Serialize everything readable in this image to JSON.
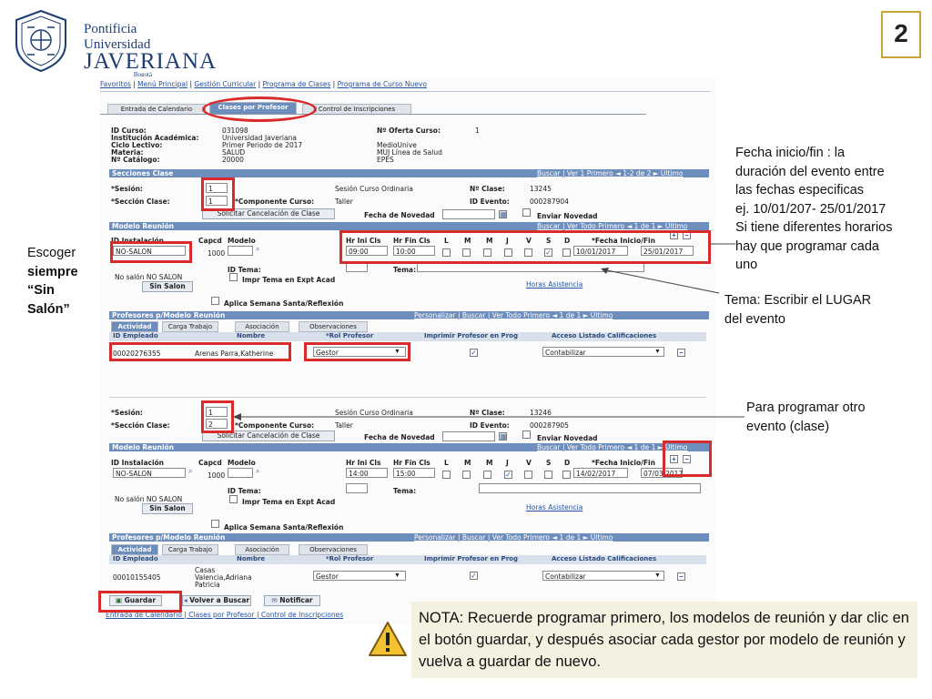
{
  "slide": {
    "page_number": "2"
  },
  "logo": {
    "line1": "Pontificia Universidad",
    "line2": "JAVERIANA",
    "line3": "Bogotá"
  },
  "breadcrumb": [
    "Favoritos",
    "Menú Principal",
    "Gestión Curricular",
    "Programa de Clases",
    "Programa de Curso Nuevo"
  ],
  "tabs": [
    "Entrada de Calendario",
    "Clases por Profesor",
    "Control de Inscripciones"
  ],
  "course_info": {
    "id_curso_label": "ID Curso:",
    "id_curso": "031098",
    "institucion_label": "Institución Académica:",
    "institucion": "Universidad Javeriana",
    "ciclo_label": "Ciclo Lectivo:",
    "ciclo": "Primer Periodo de 2017",
    "materia_label": "Materia:",
    "materia": "SALUD",
    "catalogo_label": "Nº Catálogo:",
    "catalogo": "20000",
    "oferta_label": "Nº Oferta Curso:",
    "oferta": "1",
    "medio": "MedioUnive",
    "linea": "MUJ Línea de Salud",
    "epes": "EPES"
  },
  "secciones_bar": {
    "title": "Secciones Clase",
    "links": "Buscar | Ver 1   Primero  ◄  1-2 de 2  ►  Último"
  },
  "section1": {
    "sesion_label": "*Sesión:",
    "sesion": "1",
    "sesion_desc": "Sesión Curso Ordinaria",
    "num_clase_label": "Nº Clase:",
    "num_clase": "13245",
    "seccion_label": "*Sección Clase:",
    "seccion": "1",
    "componente_label": "*Componente Curso:",
    "componente": "Taller",
    "id_evento_label": "ID Evento:",
    "id_evento": "000287904",
    "solicitar": "Solicitar Cancelación de Clase",
    "fecha_novedad_label": "Fecha de Novedad",
    "enviar_novedad": "Enviar Novedad"
  },
  "modelo_bar": {
    "title": "Modelo Reunión",
    "links": "Buscar | Ver Todo   Primero  ◄  1 de 1  ►  Último"
  },
  "modelo_headers": [
    "ID Instalación",
    "Capcd",
    "Modelo",
    "Hr Ini Cls",
    "Hr Fin Cls",
    "L",
    "M",
    "M",
    "J",
    "V",
    "S",
    "D",
    "*Fecha Inicio/Fin"
  ],
  "modelo1": {
    "instalacion": "NO-SALON",
    "capacidad": "1000",
    "hr_ini": "09:00",
    "hr_fin": "10:00",
    "fecha_ini": "10/01/2017",
    "fecha_fin": "25/01/2017",
    "id_tema_label": "ID Tema:",
    "tema_label": "Tema:",
    "no_salon": "No salón  NO SALON",
    "sin_salon_btn": "Sin Salon",
    "impr_tema": "Impr Tema en Expt Acad",
    "horas_asistencia": "Horas Asistencia",
    "aplica_semana": "Aplica Semana Santa/Reflexión"
  },
  "profesores_bar": {
    "title": "Profesores p/Modelo Reunión",
    "links": "Personalizar | Buscar | Ver Todo   Primero  ◄  1 de 1  ►  Último"
  },
  "prof_tabs": [
    "Actividad",
    "Carga Trabajo",
    "Asociación",
    "Observaciones"
  ],
  "prof_headers": [
    "ID Empleado",
    "Nombre",
    "*Rol Profesor",
    "Imprimir Profesor en Prog",
    "Acceso Listado Calificaciones"
  ],
  "prof1": {
    "id": "00020276355",
    "nombre": "Arenas Parra,Katherine",
    "rol": "Gestor",
    "acceso": "Contabilizar"
  },
  "section2": {
    "sesion_label": "*Sesión:",
    "sesion": "1",
    "sesion_desc": "Sesión Curso Ordinaria",
    "num_clase_label": "Nº Clase:",
    "num_clase": "13246",
    "seccion_label": "*Sección Clase:",
    "seccion": "2",
    "componente_label": "*Componente Curso:",
    "componente": "Taller",
    "id_evento_label": "ID Evento:",
    "id_evento": "000287905",
    "solicitar": "Solicitar Cancelación de Clase",
    "fecha_novedad_label": "Fecha de Novedad",
    "enviar_novedad": "Enviar Novedad"
  },
  "modelo2": {
    "instalacion": "NO-SALON",
    "capacidad": "1000",
    "hr_ini": "14:00",
    "hr_fin": "15:00",
    "fecha_ini": "14/02/2017",
    "fecha_fin": "07/03/2017",
    "id_tema_label": "ID Tema:",
    "tema_label": "Tema:",
    "no_salon": "No salón  NO SALON",
    "sin_salon_btn": "Sin Salon",
    "impr_tema": "Impr Tema en Expt Acad",
    "horas_asistencia": "Horas Asistencia",
    "aplica_semana": "Aplica Semana Santa/Reflexión"
  },
  "prof2": {
    "id": "00010155405",
    "nombre": "Casas Valencia,Adriana Patricia",
    "rol": "Gestor",
    "acceso": "Contabilizar"
  },
  "bottom_buttons": {
    "guardar": "Guardar",
    "volver": "Volver a Buscar",
    "notificar": "Notificar"
  },
  "bottom_links": "Entrada de Calendario | Clases por Profesor | Control de Inscripciones",
  "annotations": {
    "escoger": [
      "Escoger",
      "siempre",
      "“Sin",
      "Salón”"
    ],
    "fecha": [
      "Fecha inicio/fin : la",
      "duración del evento entre",
      "las fechas especificas",
      "ej. 10/01/207-  25/01/2017",
      "Si tiene diferentes horarios",
      "hay que programar cada",
      "uno"
    ],
    "tema": [
      "Tema: Escribir el LUGAR",
      "del evento"
    ],
    "otro": [
      "Para programar otro",
      "evento (clase)"
    ],
    "nota": "NOTA: Recuerde programar primero, los modelos de reunión y dar clic en el botón guardar, y después asociar cada gestor por modelo de reunión  y vuelva a guardar de nuevo."
  },
  "colors": {
    "accent_red": "#d92b2b",
    "header_blue": "#6d8dbc",
    "note_bg": "#f4f1e1",
    "brand_navy": "#1d3e72"
  }
}
